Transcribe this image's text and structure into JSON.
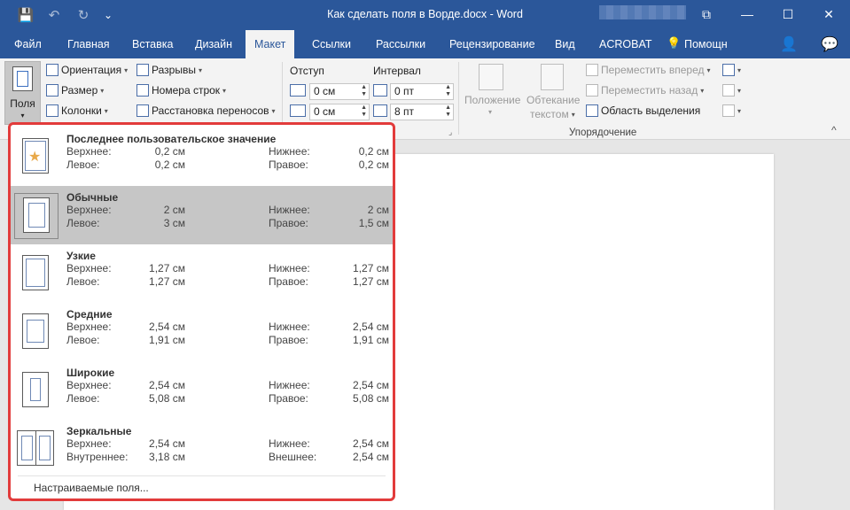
{
  "window": {
    "title": "Как сделать поля в Ворде.docx - Word",
    "qat": {
      "save_icon": "💾",
      "undo_icon": "↶",
      "redo_icon": "↻",
      "customize_icon": "⌄"
    },
    "controls": {
      "ribbon_display": "⧉",
      "minimize": "—",
      "maximize": "☐",
      "close": "✕"
    }
  },
  "tabs": [
    {
      "label": "Файл"
    },
    {
      "label": "Главная"
    },
    {
      "label": "Вставка"
    },
    {
      "label": "Дизайн"
    },
    {
      "label": "Макет"
    },
    {
      "label": "Ссылки"
    },
    {
      "label": "Рассылки"
    },
    {
      "label": "Рецензирование"
    },
    {
      "label": "Вид"
    },
    {
      "label": "ACROBAT"
    },
    {
      "label": "Помощн"
    }
  ],
  "tabs_icons": {
    "help_bulb": "💡",
    "share": "👤",
    "comment": "💬"
  },
  "ribbon": {
    "margins_button": {
      "label": "Поля"
    },
    "page_setup": {
      "orientation": "Ориентация",
      "size": "Размер",
      "columns": "Колонки",
      "breaks": "Разрывы",
      "line_numbers": "Номера строк",
      "hyphenation": "Расстановка переносов"
    },
    "indent": {
      "label": "Отступ",
      "left_value": "0 см",
      "right_value": "0 см"
    },
    "spacing": {
      "label": "Интервал",
      "before_value": "0 пт",
      "after_value": "8 пт"
    },
    "arrange": {
      "position": "Положение",
      "wrap_line1": "Обтекание",
      "wrap_line2": "текстом",
      "bring_forward": "Переместить вперед",
      "send_backward": "Переместить назад",
      "selection_pane": "Область выделения",
      "group_label": "Упорядочение"
    },
    "collapse_icon": "^"
  },
  "margins_menu": {
    "presets": [
      {
        "name": "Последнее пользовательское значение",
        "k1": "Верхнее:",
        "v1": "0,2 см",
        "k2": "Нижнее:",
        "v2": "0,2 см",
        "k3": "Левое:",
        "v3": "0,2 см",
        "k4": "Правое:",
        "v4": "0,2 см"
      },
      {
        "name": "Обычные",
        "k1": "Верхнее:",
        "v1": "2 см",
        "k2": "Нижнее:",
        "v2": "2 см",
        "k3": "Левое:",
        "v3": "3 см",
        "k4": "Правое:",
        "v4": "1,5 см"
      },
      {
        "name": "Узкие",
        "k1": "Верхнее:",
        "v1": "1,27 см",
        "k2": "Нижнее:",
        "v2": "1,27 см",
        "k3": "Левое:",
        "v3": "1,27 см",
        "k4": "Правое:",
        "v4": "1,27 см"
      },
      {
        "name": "Средние",
        "k1": "Верхнее:",
        "v1": "2,54 см",
        "k2": "Нижнее:",
        "v2": "2,54 см",
        "k3": "Левое:",
        "v3": "1,91 см",
        "k4": "Правое:",
        "v4": "1,91 см"
      },
      {
        "name": "Широкие",
        "k1": "Верхнее:",
        "v1": "2,54 см",
        "k2": "Нижнее:",
        "v2": "2,54 см",
        "k3": "Левое:",
        "v3": "5,08 см",
        "k4": "Правое:",
        "v4": "5,08 см"
      },
      {
        "name": "Зеркальные",
        "k1": "Верхнее:",
        "v1": "2,54 см",
        "k2": "Нижнее:",
        "v2": "2,54 см",
        "k3": "Внутреннее:",
        "v3": "3,18 см",
        "k4": "Внешнее:",
        "v4": "2,54 см"
      }
    ],
    "custom_label": "Настраиваемые поля...",
    "star_icon": "★"
  }
}
